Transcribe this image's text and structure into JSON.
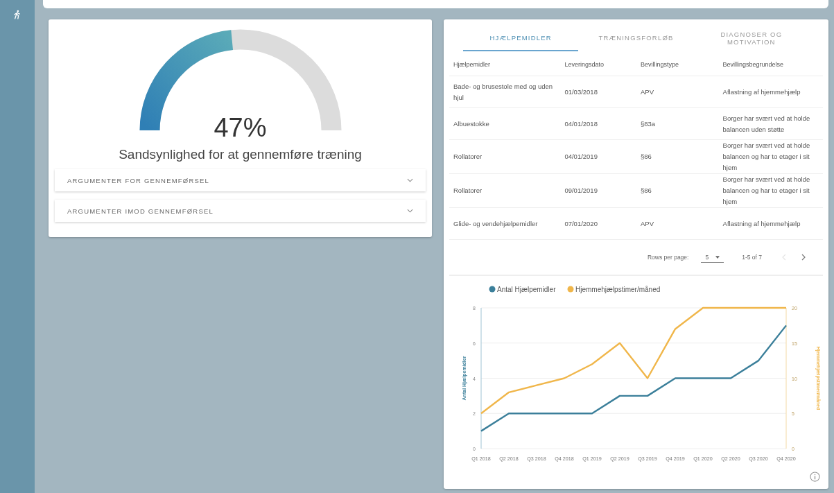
{
  "gauge": {
    "value": "47%",
    "caption": "Sandsynlighed for at gennemføre træning"
  },
  "accordions": [
    {
      "label": "ARGUMENTER FOR GENNEMFØRSEL",
      "expanded": false
    },
    {
      "label": "ARGUMENTER IMOD GENNEMFØRSEL",
      "expanded": false
    }
  ],
  "tabs": [
    {
      "label": "HJÆLPEMIDLER",
      "selected": true
    },
    {
      "label": "TRÆNINGSFORLØB",
      "selected": false
    },
    {
      "label": "DIAGNOSER OG MOTIVATION",
      "selected": false
    }
  ],
  "table": {
    "columns": [
      "Hjælpemidler",
      "Leveringsdato",
      "Bevillingstype",
      "Bevillingsbegrundelse"
    ],
    "rows": [
      [
        "Bade- og brusestole med og uden hjul",
        "01/03/2018",
        "APV",
        "Aflastning af hjemmehjælp"
      ],
      [
        "Albuestokke",
        "04/01/2018",
        "§83a",
        "Borger har svært ved at holde balancen uden støtte"
      ],
      [
        "Rollatorer",
        "04/01/2019",
        "§86",
        "Borger har svært ved at holde balancen og har to etager i sit hjem"
      ],
      [
        "Rollatorer",
        "09/01/2019",
        "§86",
        "Borger har svært ved at holde balancen og har to etager i sit hjem"
      ],
      [
        "Glide- og vendehjælpemidler",
        "07/01/2020",
        "APV",
        "Aflastning af hjemmehjælp"
      ]
    ]
  },
  "pagination": {
    "rows_label": "Rows per page:",
    "rows_value": "5",
    "range": "1-5 of 7",
    "buttons": [
      {
        "kind": "prev",
        "disabled": true
      },
      {
        "kind": "next",
        "disabled": false
      }
    ]
  },
  "chart": {
    "chart_data": {
      "type": "line",
      "categories": [
        "Q1 2018",
        "Q2 2018",
        "Q3 2018",
        "Q4 2018",
        "Q1 2019",
        "Q2 2019",
        "Q3 2019",
        "Q4 2019",
        "Q1 2020",
        "Q2 2020",
        "Q3 2020",
        "Q4 2020"
      ],
      "ylabel": "Antal Hjælpemidler",
      "y2label": "Hjemmehjælpstimer/måned",
      "ylim": [
        0,
        8
      ],
      "y2lim": [
        0,
        20
      ],
      "grid": true,
      "legend": "top",
      "yticks": [
        0,
        2,
        4,
        6,
        8
      ],
      "y2ticks": [
        0,
        5,
        10,
        15,
        20
      ],
      "series": [
        {
          "name": "Antal Hjælpemidler",
          "color": "#3b7f9a",
          "values": [
            1,
            2,
            2,
            2,
            2,
            3,
            3,
            4,
            4,
            4,
            5,
            7
          ]
        },
        {
          "name": "Hjemmehjælpstimer/måned",
          "color": "#f0b64a",
          "axis": "y2",
          "values": [
            5,
            8,
            9,
            10,
            12,
            15,
            10,
            17,
            20,
            20,
            20,
            20
          ]
        }
      ]
    }
  }
}
